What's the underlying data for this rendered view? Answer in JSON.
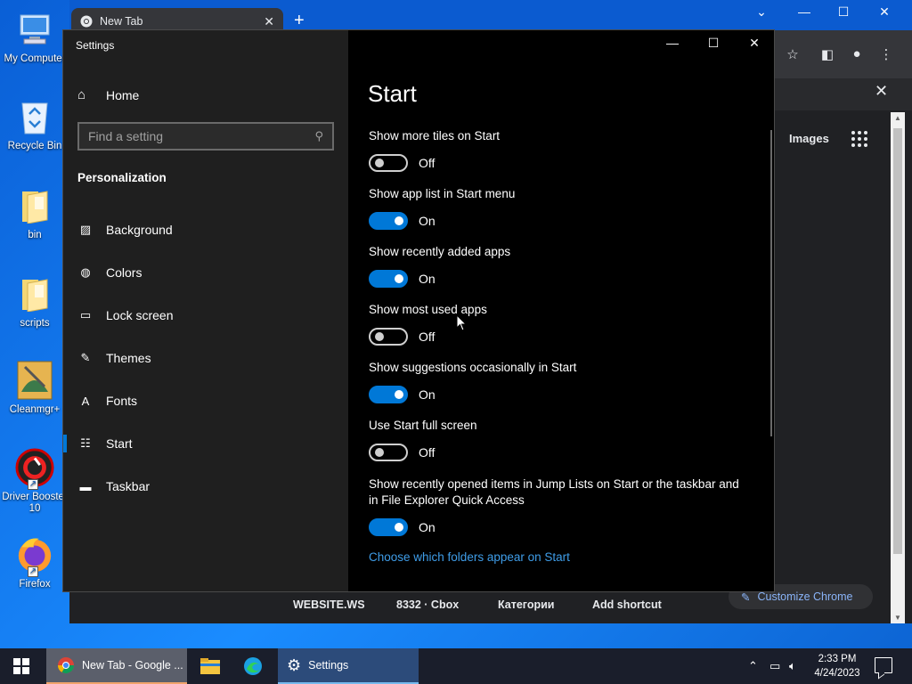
{
  "desktop": {
    "icons": [
      {
        "label": "My Computer"
      },
      {
        "label": "Recycle Bin"
      },
      {
        "label": "bin"
      },
      {
        "label": "scripts"
      },
      {
        "label": "Cleanmgr+"
      },
      {
        "label": "Driver Booster 10"
      },
      {
        "label": "Firefox"
      }
    ]
  },
  "chrome": {
    "tab_title": "New Tab",
    "tab_close": "✕",
    "new_tab": "+",
    "images_link": "Images",
    "shortcuts": [
      {
        "label": "WEBSITE.WS"
      },
      {
        "label": "8332 · Cbox"
      },
      {
        "label": "Категории"
      },
      {
        "label": "Add shortcut"
      }
    ],
    "customize_label": "Customize Chrome",
    "side_close": "✕"
  },
  "settings": {
    "window_title": "Settings",
    "home_label": "Home",
    "search_placeholder": "Find a setting",
    "section_label": "Personalization",
    "nav": [
      {
        "label": "Background",
        "icon": "image-icon"
      },
      {
        "label": "Colors",
        "icon": "palette-icon"
      },
      {
        "label": "Lock screen",
        "icon": "lock-screen-icon"
      },
      {
        "label": "Themes",
        "icon": "themes-icon"
      },
      {
        "label": "Fonts",
        "icon": "fonts-icon"
      },
      {
        "label": "Start",
        "icon": "start-icon",
        "active": true
      },
      {
        "label": "Taskbar",
        "icon": "taskbar-icon"
      }
    ],
    "page_title": "Start",
    "options": [
      {
        "label": "Show more tiles on Start",
        "state": "Off",
        "on": false
      },
      {
        "label": "Show app list in Start menu",
        "state": "On",
        "on": true
      },
      {
        "label": "Show recently added apps",
        "state": "On",
        "on": true
      },
      {
        "label": "Show most used apps",
        "state": "Off",
        "on": false
      },
      {
        "label": "Show suggestions occasionally in Start",
        "state": "On",
        "on": true
      },
      {
        "label": "Use Start full screen",
        "state": "Off",
        "on": false
      },
      {
        "label": "Show recently opened items in Jump Lists on Start or the taskbar and in File Explorer Quick Access",
        "state": "On",
        "on": true
      }
    ],
    "folders_link": "Choose which folders appear on Start"
  },
  "taskbar": {
    "chrome_task": "New Tab - Google ...",
    "settings_task": "Settings",
    "time": "2:33 PM",
    "date": "4/24/2023"
  },
  "colors": {
    "accent": "#0078d7",
    "link": "#3f9de8",
    "settings_left_bg": "#1f1f1f",
    "settings_right_bg": "#000000"
  }
}
